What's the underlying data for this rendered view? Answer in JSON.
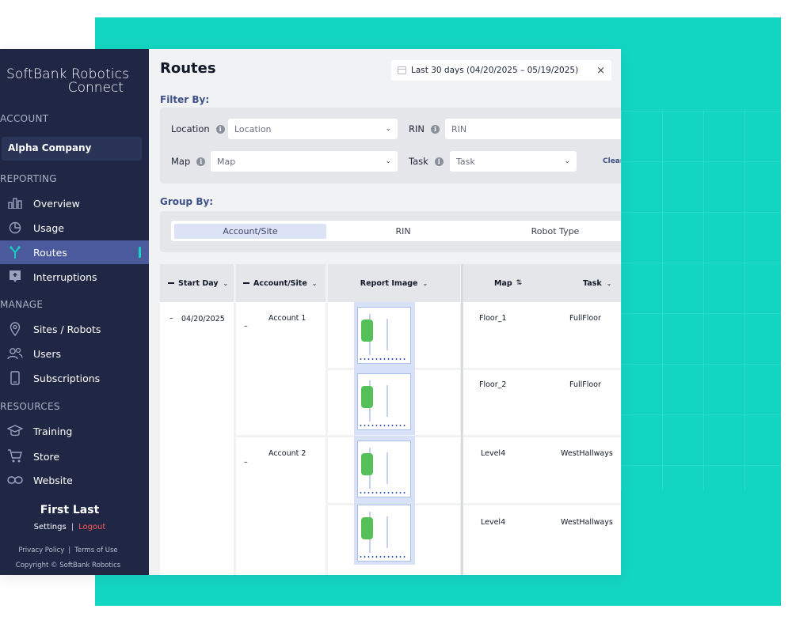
{
  "brand": {
    "line1": "SoftBank Robotics",
    "line2": "Connect"
  },
  "sidebar": {
    "account_heading": "ACCOUNT",
    "company": "Alpha Company",
    "reporting_heading": "REPORTING",
    "reporting_items": [
      {
        "label": "Overview",
        "icon": "bar-chart-icon"
      },
      {
        "label": "Usage",
        "icon": "pie-chart-icon"
      },
      {
        "label": "Routes",
        "icon": "routes-icon",
        "active": true
      },
      {
        "label": "Interruptions",
        "icon": "interruption-icon"
      }
    ],
    "manage_heading": "MANAGE",
    "manage_items": [
      {
        "label": "Sites / Robots",
        "icon": "location-pin-icon"
      },
      {
        "label": "Users",
        "icon": "users-icon"
      },
      {
        "label": "Subscriptions",
        "icon": "phone-icon"
      }
    ],
    "resources_heading": "RESOURCES",
    "resources_items": [
      {
        "label": "Training",
        "icon": "graduation-cap-icon"
      },
      {
        "label": "Store",
        "icon": "cart-icon"
      },
      {
        "label": "Website",
        "icon": "link-icon"
      }
    ],
    "user": {
      "name": "First Last",
      "settings": "Settings",
      "separator": "|",
      "logout": "Logout"
    },
    "footer": {
      "privacy": "Privacy Policy",
      "separator": "|",
      "terms": "Terms of Use",
      "copyright": "Copyright © SoftBank Robotics"
    }
  },
  "main": {
    "title": "Routes",
    "date_range": "Last 30 days (04/20/2025 – 05/19/2025)",
    "date_clear": "×",
    "filter_heading": "Filter By:",
    "filters": {
      "location_label": "Location",
      "location_value": "Location",
      "rin_label": "RIN",
      "rin_value": "RIN",
      "map_label": "Map",
      "map_value": "Map",
      "task_label": "Task",
      "task_value": "Task",
      "clear": "Clear"
    },
    "group_heading": "Group By:",
    "group_options": [
      "Account/Site",
      "RIN",
      "Robot Type"
    ],
    "group_selected": "Account/Site"
  },
  "table": {
    "columns": [
      "Start Day",
      "Account/Site",
      "Report Image",
      "Map",
      "Task"
    ],
    "start_day": "04/20/2025",
    "collapse_symbol": "–",
    "groups": [
      {
        "account": "Account 1",
        "rows": [
          {
            "map": "Floor_1",
            "task": "FullFloor"
          },
          {
            "map": "Floor_2",
            "task": "FullFloor"
          }
        ]
      },
      {
        "account": "Account 2",
        "rows": [
          {
            "map": "Level4",
            "task": "WestHallways"
          },
          {
            "map": "Level4",
            "task": "WestHallways"
          }
        ]
      }
    ]
  },
  "colors": {
    "teal_accent": "#13d6c2",
    "sidebar_bg": "#1f2745",
    "active_nav": "#4a5a9c",
    "logout_red": "#ff5a5a"
  }
}
